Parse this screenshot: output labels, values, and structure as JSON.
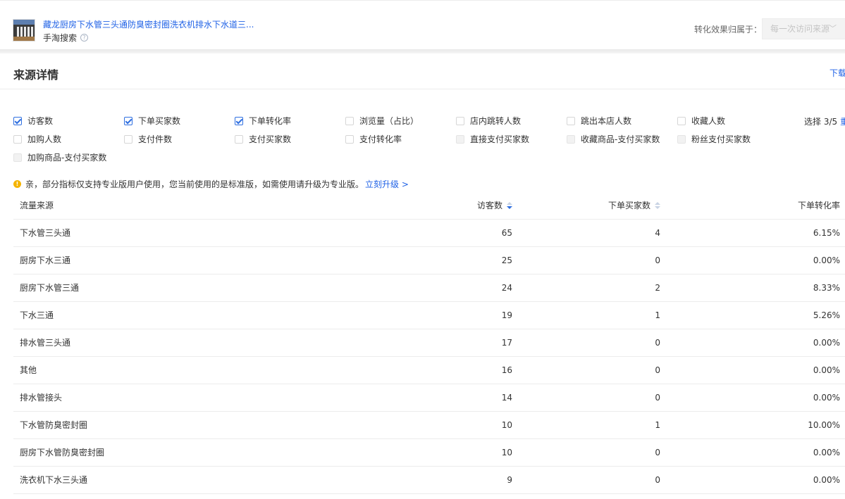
{
  "product": {
    "title": "藏龙厨房下水管三头通防臭密封圈洗衣机排水下水道三...",
    "source_channel": "手淘搜索",
    "help_glyph": "?"
  },
  "attribution": {
    "label": "转化效果归属于：",
    "selected": "每一次访问来源"
  },
  "section": {
    "title": "来源详情",
    "download_label": "下载"
  },
  "metrics": [
    {
      "label": "访客数",
      "checked": true
    },
    {
      "label": "下单买家数",
      "checked": true
    },
    {
      "label": "下单转化率",
      "checked": true
    },
    {
      "label": "浏览量（占比）",
      "checked": false
    },
    {
      "label": "店内跳转人数",
      "checked": false
    },
    {
      "label": "跳出本店人数",
      "checked": false
    },
    {
      "label": "收藏人数",
      "checked": false
    },
    {
      "label": "加购人数",
      "checked": false
    },
    {
      "label": "支付件数",
      "checked": false
    },
    {
      "label": "支付买家数",
      "checked": false
    },
    {
      "label": "支付转化率",
      "checked": false
    },
    {
      "label": "直接支付买家数",
      "checked": false,
      "disabled": true
    },
    {
      "label": "收藏商品-支付买家数",
      "checked": false,
      "disabled": true
    },
    {
      "label": "粉丝支付买家数",
      "checked": false,
      "disabled": true
    },
    {
      "label": "加购商品-支付买家数",
      "checked": false,
      "disabled": true
    }
  ],
  "selection": {
    "count_text": "选择 3/5",
    "reset_label": "重置"
  },
  "notice": {
    "icon_glyph": "!",
    "text": "亲，部分指标仅支持专业版用户使用，您当前使用的是标准版，如需使用请升级为专业版。",
    "link": "立刻升级 >"
  },
  "table": {
    "columns": [
      "流量来源",
      "访客数",
      "下单买家数",
      "下单转化率"
    ],
    "rows": [
      {
        "source": "下水管三头通",
        "visitors": "65",
        "buyers": "4",
        "rate": "6.15%"
      },
      {
        "source": "厨房下水三通",
        "visitors": "25",
        "buyers": "0",
        "rate": "0.00%"
      },
      {
        "source": "厨房下水管三通",
        "visitors": "24",
        "buyers": "2",
        "rate": "8.33%"
      },
      {
        "source": "下水三通",
        "visitors": "19",
        "buyers": "1",
        "rate": "5.26%"
      },
      {
        "source": "排水管三头通",
        "visitors": "17",
        "buyers": "0",
        "rate": "0.00%"
      },
      {
        "source": "其他",
        "visitors": "16",
        "buyers": "0",
        "rate": "0.00%"
      },
      {
        "source": "排水管接头",
        "visitors": "14",
        "buyers": "0",
        "rate": "0.00%"
      },
      {
        "source": "下水管防臭密封圈",
        "visitors": "10",
        "buyers": "1",
        "rate": "10.00%"
      },
      {
        "source": "厨房下水管防臭密封圈",
        "visitors": "10",
        "buyers": "0",
        "rate": "0.00%"
      },
      {
        "source": "洗衣机下水三头通",
        "visitors": "9",
        "buyers": "0",
        "rate": "0.00%"
      }
    ]
  },
  "colors": {
    "accent": "#2062e6",
    "checkbox": "#2f6fe0",
    "warning": "#f5b400",
    "border": "#ececec"
  }
}
